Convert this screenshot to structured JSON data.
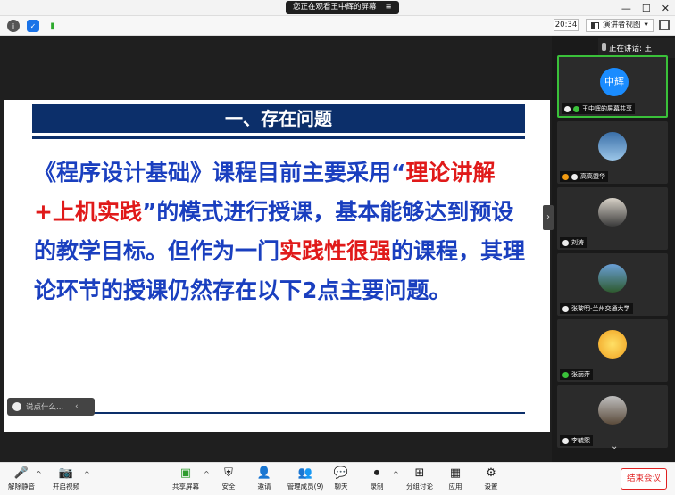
{
  "window": {
    "share_notice": "您正在观看王中辉的屏幕",
    "share_notice_icon": "≡",
    "minimize": "—",
    "maximize": "☐",
    "close": "✕"
  },
  "toolbar": {
    "time": "20:34",
    "view_label": "演讲者视图",
    "view_caret": "▾"
  },
  "slide": {
    "heading": "一、存在问题",
    "body_segments": [
      {
        "text": "《程序设计基础》课程目前主要采用“",
        "highlight": false
      },
      {
        "text": "理论讲解+上机实践",
        "highlight": true
      },
      {
        "text": "”的模式进行授课，基本能够达到预设的教学目标。但作为一门",
        "highlight": false
      },
      {
        "text": "实践性很强",
        "highlight": true
      },
      {
        "text": "的课程，其理论环节的授课仍然存在以下2点主要问题。",
        "highlight": false
      }
    ],
    "colors": {
      "heading_bg": "#0c2f6a",
      "body_text": "#1a3fbf",
      "highlight": "#e01a1a"
    }
  },
  "chat": {
    "placeholder": "说点什么...",
    "collapse": "‹"
  },
  "sidebar_toggle": "›",
  "sidebar": {
    "speaking_label": "正在讲话: 王",
    "participants": [
      {
        "name": "王中辉的屏幕共享",
        "avatar_text": "中辉",
        "active": true
      },
      {
        "name": "高高盟华",
        "avatar_text": "",
        "active": false
      },
      {
        "name": "刘涛",
        "avatar_text": "",
        "active": false
      },
      {
        "name": "张黎明-兰州交通大学",
        "avatar_text": "",
        "active": false
      },
      {
        "name": "张丽萍",
        "avatar_text": "",
        "active": false
      },
      {
        "name": "李毓熙",
        "avatar_text": "",
        "active": false
      }
    ],
    "more": "⌄"
  },
  "bottombar": {
    "items": [
      {
        "label": "解除静音",
        "icon": "🎤"
      },
      {
        "label": "开启视频",
        "icon": "📷"
      },
      {
        "label": "共享屏幕",
        "icon": "▣"
      },
      {
        "label": "安全",
        "icon": "⛨"
      },
      {
        "label": "邀请",
        "icon": "👤"
      },
      {
        "label": "管理成员(9)",
        "icon": "👥"
      },
      {
        "label": "聊天",
        "icon": "💬"
      },
      {
        "label": "录制",
        "icon": "⏺"
      },
      {
        "label": "分组讨论",
        "icon": "⊞"
      },
      {
        "label": "应用",
        "icon": "▦"
      },
      {
        "label": "设置",
        "icon": "⚙"
      }
    ],
    "caret": "^",
    "end_label": "结束会议"
  }
}
